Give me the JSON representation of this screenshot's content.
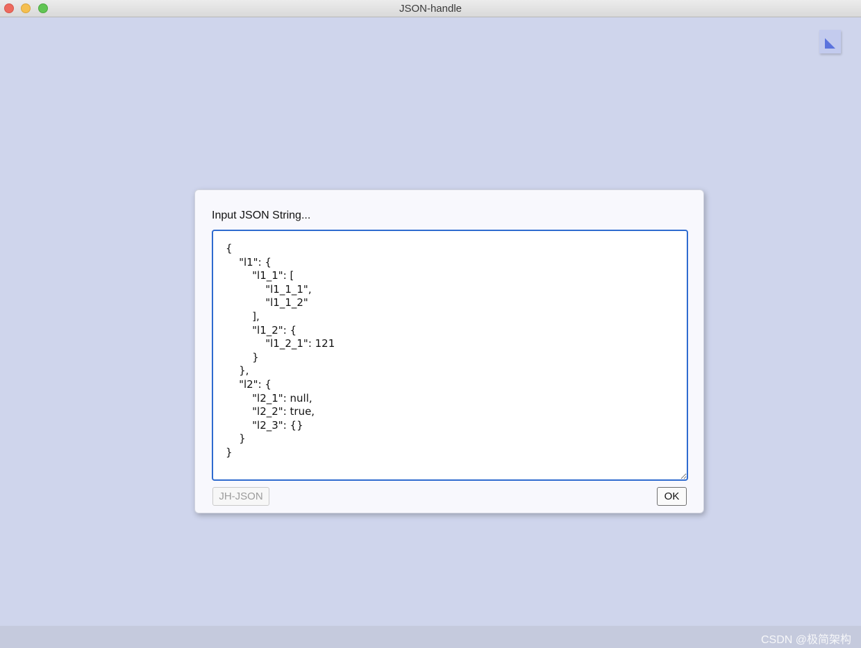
{
  "window": {
    "title": "JSON-handle"
  },
  "corner_button": {
    "icon": "triangle-corner-icon",
    "color": "#5b73dd"
  },
  "dialog": {
    "label": "Input JSON String...",
    "json_text": "{\n    \"l1\": {\n        \"l1_1\": [\n            \"l1_1_1\",\n            \"l1_1_2\"\n        ],\n        \"l1_2\": {\n            \"l1_2_1\": 121\n        }\n    },\n    \"l2\": {\n        \"l2_1\": null,\n        \"l2_2\": true,\n        \"l2_3\": {}\n    }\n}",
    "jh_button_label": "JH-JSON",
    "ok_button_label": "OK"
  },
  "watermark": "CSDN @极简架构",
  "colors": {
    "background": "#cfd5ec",
    "dialog_background": "#f8f8fd",
    "input_border": "#2f6bcf"
  }
}
